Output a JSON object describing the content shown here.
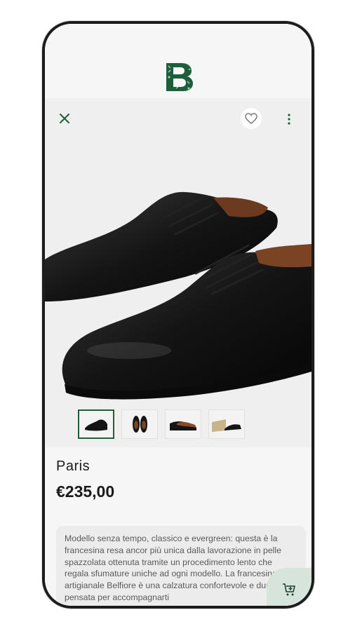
{
  "header": {
    "logo_icon": "belfiore-b-logo",
    "brand_color": "#1d5e3c"
  },
  "toolbar": {
    "close_icon": "close-icon",
    "favorite_icon": "heart-icon",
    "more_icon": "more-vertical-icon"
  },
  "gallery": {
    "thumbnails": [
      {
        "name": "front-pair-view",
        "selected": true
      },
      {
        "name": "top-view",
        "selected": false
      },
      {
        "name": "side-view",
        "selected": false
      },
      {
        "name": "box-view",
        "selected": false
      }
    ]
  },
  "product": {
    "name": "Paris",
    "price": "€235,00",
    "description": "Modello senza tempo, classico e evergreen: questa è la francesina resa ancor più unica dalla lavorazione in pelle spazzolata ottenuta tramite un procedimento lento che regala sfumature uniche ad ogni modello. La francesina artigianale Belfiore è una calzatura confortevole e durevole, pensata per accompagnarti"
  },
  "cart_button": {
    "icon": "add-to-cart-icon",
    "bg_color": "#d7e4dc"
  }
}
